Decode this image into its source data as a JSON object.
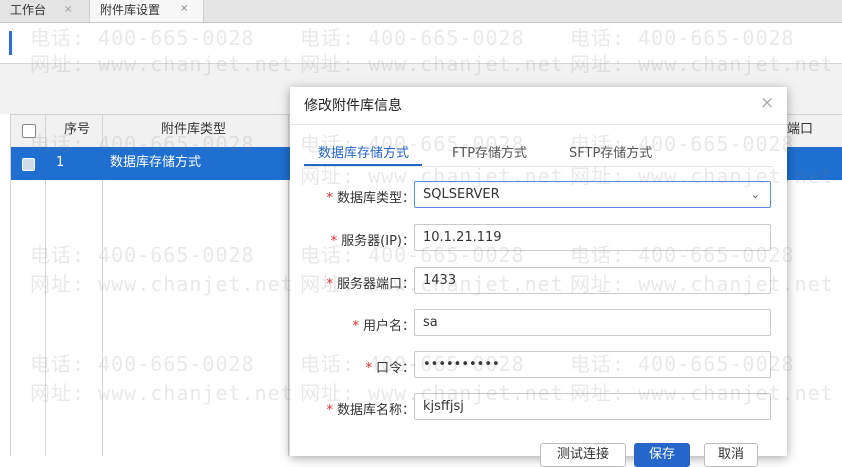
{
  "tabs": [
    {
      "label": "工作台",
      "close": "×"
    },
    {
      "label": "附件库设置",
      "close": "×"
    }
  ],
  "grid": {
    "headers": {
      "index": "序号",
      "type": "附件库类型",
      "port_partial": "端口"
    },
    "rows": [
      {
        "index": "1",
        "type": "数据库存储方式"
      }
    ]
  },
  "dialog": {
    "title": "修改附件库信息",
    "close": "×",
    "tabs": [
      "数据库存储方式",
      "FTP存储方式",
      "SFTP存储方式"
    ],
    "active_tab": 0,
    "fields": {
      "db_type": {
        "label": "数据库类型：",
        "value": "SQLSERVER",
        "required": true
      },
      "server": {
        "label": "服务器(IP)：",
        "value": "10.1.21.119",
        "required": true
      },
      "port": {
        "label": "服务器端口：",
        "value": "1433",
        "required": true
      },
      "user": {
        "label": "用户名：",
        "value": "sa",
        "required": true
      },
      "password": {
        "label": "口令：",
        "value": "••••••••••",
        "required": true
      },
      "db_name": {
        "label": "数据库名称：",
        "value": "kjsffjsj",
        "required": true
      }
    },
    "buttons": {
      "test": "测试连接",
      "save": "保存",
      "cancel": "取消"
    }
  },
  "watermark": {
    "phone": "电话: 400-665-0028",
    "site": "网址: www.chanjet.net"
  },
  "colors": {
    "accent": "#2466c9",
    "selected_row": "#1f6fd0",
    "required": "#e02b2b"
  }
}
